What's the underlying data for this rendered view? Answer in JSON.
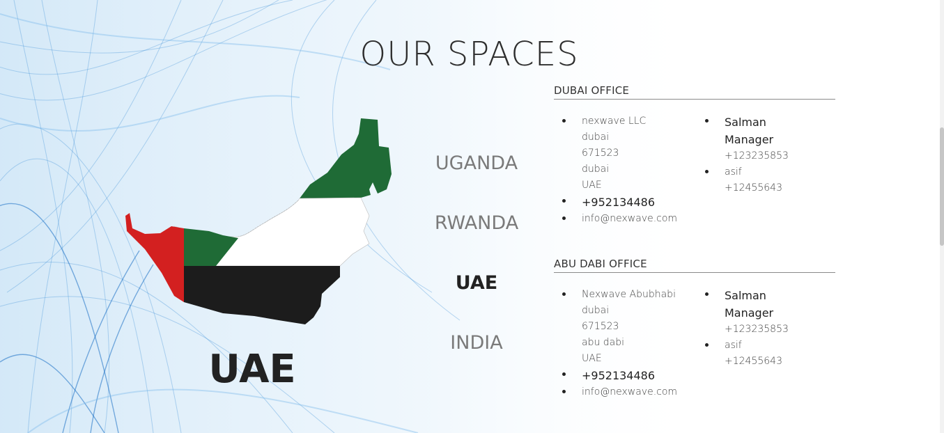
{
  "page": {
    "title": "OUR SPACES"
  },
  "countries": [
    "UGANDA",
    "RWANDA",
    "UAE",
    "INDIA"
  ],
  "active_country": "UAE",
  "map": {
    "label": "UAE",
    "flag_colors": {
      "red": "#d32020",
      "green": "#1f6b36",
      "white": "#ffffff",
      "black": "#1c1c1c"
    }
  },
  "offices": [
    {
      "heading": "DUBAI OFFICE",
      "address": {
        "company": "nexwave LLC",
        "city": "dubai",
        "postal": "671523",
        "region": "dubai",
        "country": "UAE"
      },
      "phone": "+952134486",
      "email": "info@nexwave.com",
      "contacts": [
        {
          "name": "Salman",
          "role": "Manager",
          "phone": "+123235853"
        },
        {
          "name": "asif",
          "phone": "+12455643"
        }
      ]
    },
    {
      "heading": "ABU DABI OFFICE",
      "address": {
        "company": "Nexwave Abubhabi",
        "city": "dubai",
        "postal": "671523",
        "region": "abu dabi",
        "country": "UAE"
      },
      "phone": "+952134486",
      "email": "info@nexwave.com",
      "contacts": [
        {
          "name": "Salman",
          "role": "Manager",
          "phone": "+123235853"
        },
        {
          "name": "asif",
          "phone": "+12455643"
        }
      ]
    }
  ]
}
